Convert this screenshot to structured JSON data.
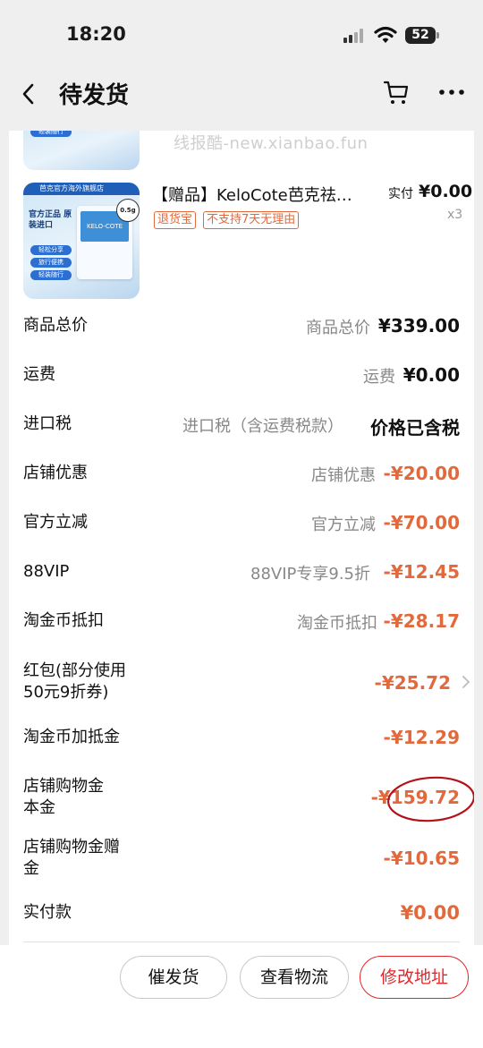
{
  "status_bar": {
    "time": "18:20",
    "battery": "52"
  },
  "nav": {
    "title": "待发货"
  },
  "watermark": "线报酷-new.xianbao.fun",
  "product": {
    "title": "【赠品】KeloCote芭克祛…",
    "tags": [
      "退货宝",
      "不支持7天无理由"
    ],
    "paid_label": "实付",
    "paid_amount": "¥0.00",
    "quantity": "x3",
    "image_texts": {
      "brand_strip": "芭克官方海外旗舰店",
      "headline": "官方正品 原装进口",
      "pills": [
        "轻松分享",
        "旅行便携",
        "轻装随行"
      ],
      "packet_brand": "KELO-COTE",
      "packet_size": "0.5g"
    }
  },
  "summary": [
    {
      "label": "商品总价",
      "mid": "商品总价",
      "amount": "¥339.00",
      "color": "dark"
    },
    {
      "label": "运费",
      "mid": "运费",
      "amount": "¥0.00",
      "color": "dark"
    },
    {
      "label": "进口税",
      "mid": "进口税（含运费税款）",
      "amount": "价格已含税",
      "color": "dark"
    },
    {
      "label": "店铺优惠",
      "mid": "店铺优惠",
      "amount": "-¥20.00",
      "color": "red"
    },
    {
      "label": "官方立减",
      "mid": "官方立减",
      "amount": "-¥70.00",
      "color": "red"
    },
    {
      "label": "88VIP",
      "mid": "88VIP专享9.5折",
      "amount": "-¥12.45",
      "color": "red"
    },
    {
      "label": "淘金币抵扣",
      "mid": "淘金币抵扣",
      "amount": "-¥28.17",
      "color": "red"
    },
    {
      "label": "红包(部分使用 50元9折券)",
      "mid": "",
      "amount": "-¥25.72",
      "color": "red"
    },
    {
      "label": "淘金币加抵金",
      "mid": "",
      "amount": "-¥12.29",
      "color": "red"
    },
    {
      "label": "店铺购物金 本金",
      "mid": "",
      "amount": "-¥159.72",
      "color": "red"
    },
    {
      "label": "店铺购物金赠 金",
      "mid": "",
      "amount": "-¥10.65",
      "color": "red"
    },
    {
      "label": "实付款",
      "mid": "",
      "amount": "¥0.00",
      "color": "red"
    }
  ],
  "buttons": {
    "urge": "催发货",
    "logistics": "查看物流",
    "address": "修改地址"
  },
  "colors": {
    "accent_red": "#e2272b",
    "price_orange": "#e2693c",
    "circle_annotation": "#b3121a"
  }
}
